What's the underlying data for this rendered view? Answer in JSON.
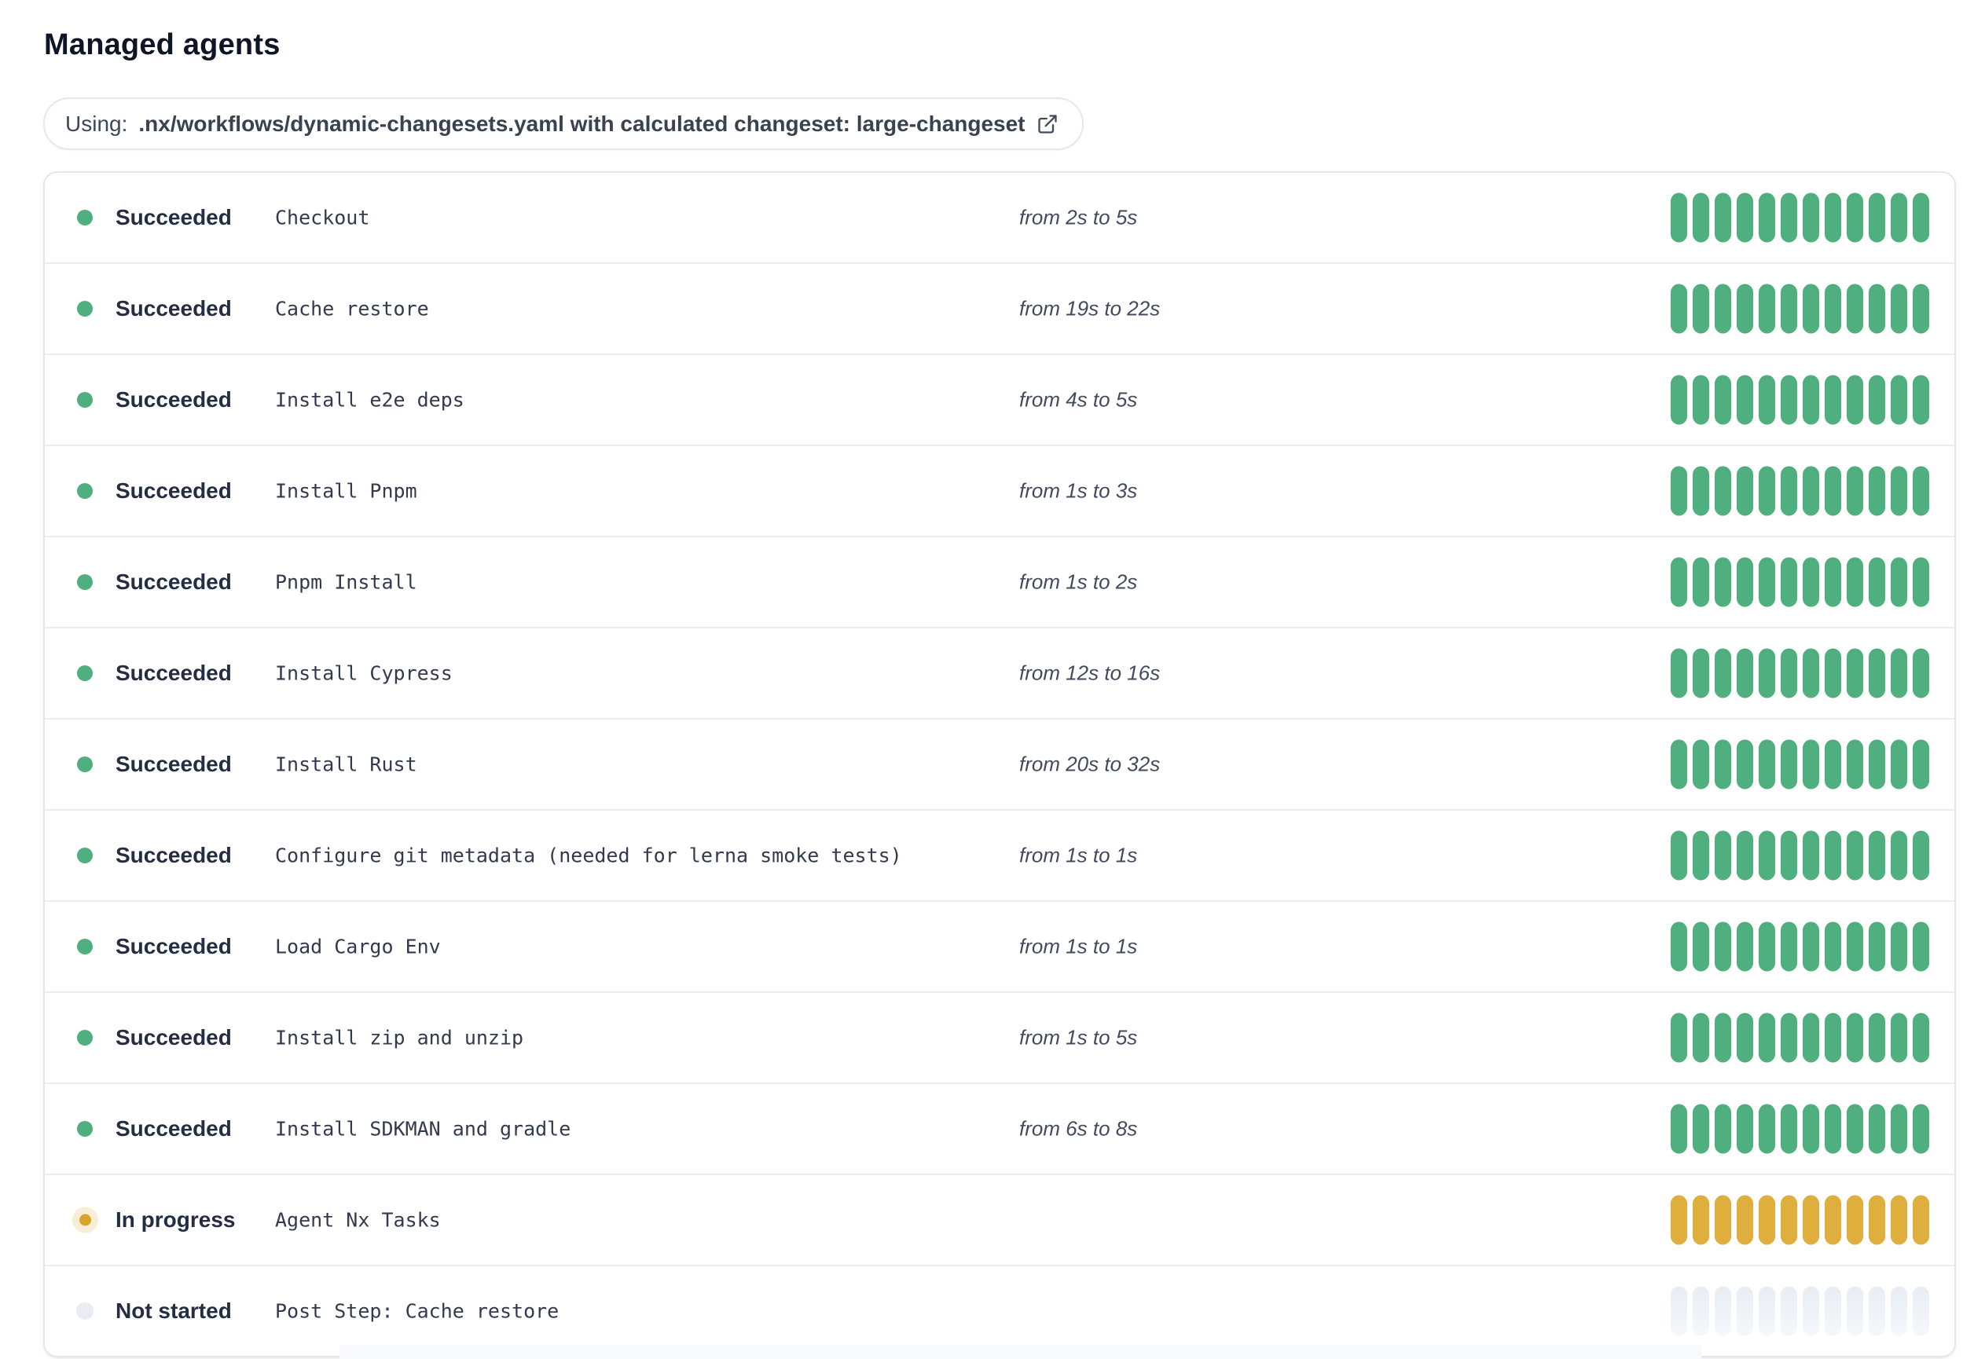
{
  "page": {
    "title": "Managed agents"
  },
  "banner": {
    "prefix": "Using:",
    "workflow": ".nx/workflows/dynamic-changesets.yaml with calculated changeset: large-changeset",
    "icon": "external-link-icon"
  },
  "colors": {
    "succeeded": "#50af7e",
    "in_progress": "#dfaf3e",
    "in_progress_dot": "#d9a42e",
    "not_started": "#e9eef4",
    "text_dark": "#242e42"
  },
  "agents": {
    "segments_per_row": 12,
    "rows": [
      {
        "status": "Succeeded",
        "state": "succeeded",
        "name": "Checkout",
        "duration": "from 2s to 5s"
      },
      {
        "status": "Succeeded",
        "state": "succeeded",
        "name": "Cache restore",
        "duration": "from 19s to 22s"
      },
      {
        "status": "Succeeded",
        "state": "succeeded",
        "name": "Install e2e deps",
        "duration": "from 4s to 5s"
      },
      {
        "status": "Succeeded",
        "state": "succeeded",
        "name": "Install Pnpm",
        "duration": "from 1s to 3s"
      },
      {
        "status": "Succeeded",
        "state": "succeeded",
        "name": "Pnpm Install",
        "duration": "from 1s to 2s"
      },
      {
        "status": "Succeeded",
        "state": "succeeded",
        "name": "Install Cypress",
        "duration": "from 12s to 16s"
      },
      {
        "status": "Succeeded",
        "state": "succeeded",
        "name": "Install Rust",
        "duration": "from 20s to 32s"
      },
      {
        "status": "Succeeded",
        "state": "succeeded",
        "name": "Configure git metadata (needed for lerna smoke tests)",
        "duration": "from 1s to 1s"
      },
      {
        "status": "Succeeded",
        "state": "succeeded",
        "name": "Load Cargo Env",
        "duration": "from 1s to 1s"
      },
      {
        "status": "Succeeded",
        "state": "succeeded",
        "name": "Install zip and unzip",
        "duration": "from 1s to 5s"
      },
      {
        "status": "Succeeded",
        "state": "succeeded",
        "name": "Install SDKMAN and gradle",
        "duration": "from 6s to 8s"
      },
      {
        "status": "In progress",
        "state": "in-progress",
        "name": "Agent Nx Tasks",
        "duration": ""
      },
      {
        "status": "Not started",
        "state": "not-started",
        "name": "Post Step: Cache restore",
        "duration": ""
      }
    ]
  }
}
